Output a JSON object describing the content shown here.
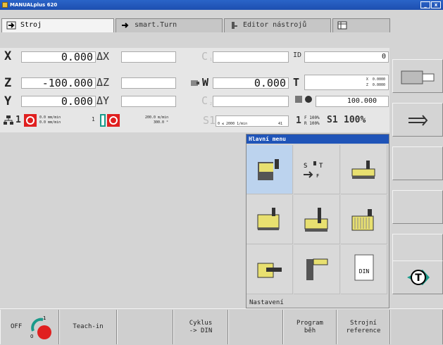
{
  "window": {
    "title": "MANUALplus 620"
  },
  "tabs": [
    {
      "label": "Stroj",
      "icon": "machine-icon"
    },
    {
      "label": "smart.Turn",
      "icon": "smart-turn-icon"
    },
    {
      "label": "Editor nástrojů",
      "icon": "tool-editor-icon"
    },
    {
      "label": "",
      "icon": "table-icon"
    }
  ],
  "axes": {
    "x": {
      "label": "X",
      "value": "0.000",
      "delta_label": "ΔX"
    },
    "z": {
      "label": "Z",
      "value": "-100.000",
      "delta_label": "ΔZ"
    },
    "y": {
      "label": "Y",
      "value": "0.000",
      "delta_label": "ΔY"
    }
  },
  "extra": {
    "c1_label": "C",
    "c1_sub": "1",
    "c2_label": "C",
    "c2_sub": "2",
    "w_label": "W",
    "w_value": "0.000",
    "id_label": "ID",
    "id_value": "0",
    "t_label": "T",
    "t_x": "X  0.0000",
    "t_z": "Z  0.0000",
    "spindle_pct": "100.000",
    "feed_line1": "F 100%",
    "feed_line2": "R 100%",
    "s1_label": "S1",
    "s1_pct": "100%"
  },
  "status_row": {
    "channel": "1",
    "feed1": "0.0 mm/min",
    "feed2": "0.0 mm/min",
    "spindle_num": "1",
    "rpm1": "200.0 m/min",
    "rpm2": "300.0 °",
    "s_label": "S1",
    "scale": "0 ≤ 2000 1/min",
    "gear": "41",
    "one": "1"
  },
  "menu": {
    "title": "Hlavní menu",
    "footer": "Nastavení",
    "items": [
      "facing-cycle-icon",
      "s-t-f-icon",
      "turning-cycle-icon",
      "longitudinal-roughing-icon",
      "recess-cycle-icon",
      "contour-cycle-icon",
      "drilling-cycle-icon",
      "thread-cycle-icon",
      "din-program-icon"
    ],
    "din_text": "DIN",
    "stf_s": "S",
    "stf_t": "T",
    "stf_f": "F"
  },
  "softkeys": [
    {
      "label": "OFF"
    },
    {
      "label": "Teach-in"
    },
    {
      "label": ""
    },
    {
      "label": "Cyklus\n-> DIN"
    },
    {
      "label": ""
    },
    {
      "label": "Program\nběh"
    },
    {
      "label": "Strojní\nreference"
    },
    {
      "label": ""
    }
  ],
  "colors": {
    "title_bar": "#1d4fb0",
    "menu_header": "#1f54b8",
    "selection": "#bcd3ee",
    "accent_red": "#e02020",
    "teal": "#1a9a8a"
  }
}
